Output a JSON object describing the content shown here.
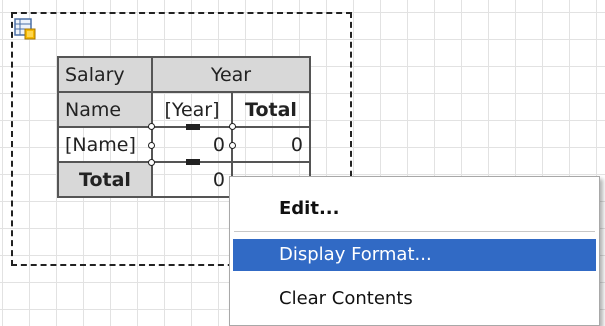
{
  "crosstab": {
    "corner_label": "Salary",
    "column_group_label": "Year",
    "row_header_label": "Name",
    "column_field": "[Year]",
    "column_total_label": "Total",
    "row_field": "[Name]",
    "cell_value": "0",
    "row_total_value": "0",
    "grand_total_label": "Total",
    "grand_total_value": "0"
  },
  "context_menu": {
    "items": [
      {
        "label": "Edit..."
      },
      {
        "label": "Display Format..."
      },
      {
        "label": "Clear Contents"
      }
    ]
  },
  "icons": {
    "component_icon": "crosstab-component-icon"
  },
  "colors": {
    "header_fill": "#d8d8d8",
    "menu_highlight": "#316ac5",
    "grid_line": "#e2e2e2"
  }
}
